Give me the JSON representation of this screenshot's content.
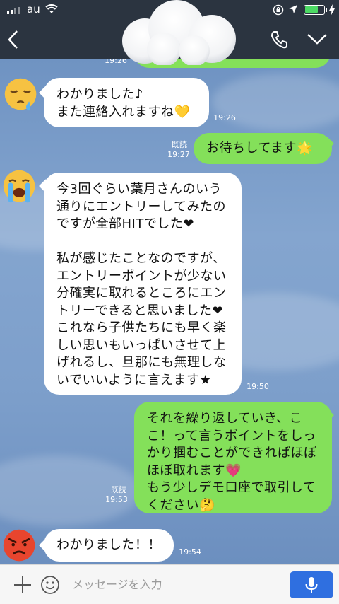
{
  "status": {
    "carrier": "au"
  },
  "messages": [
    {
      "id": "m0",
      "dir": "out",
      "time": "19:26",
      "partial": true
    },
    {
      "id": "m1",
      "dir": "in",
      "text": "わかりました♪\nまた連絡入れますね💛",
      "time": "19:26",
      "avatar": "sleepy-face-emoji"
    },
    {
      "id": "m2",
      "dir": "out",
      "text": "お待ちしてます🌟",
      "read": "既読",
      "time": "19:27"
    },
    {
      "id": "m3",
      "dir": "in",
      "text": "今3回ぐらい葉月さんのいう\n通りにエントリーしてみたの\nですが全部HITでした❤\n\n私が感じたことなのですが、\nエントリーポイントが少ない\n分確実に取れるところにエン\nトリーできると思いました❤\nこれなら子供たちにも早く楽\nしい思いもいっぱいさせて上\nげれるし、旦那にも無理しな\nいでいいように言えます★",
      "time": "19:50",
      "avatar": "crying-face-emoji"
    },
    {
      "id": "m4",
      "dir": "out",
      "text": "それを繰り返していき、こ\nこ！って言うポイントをしっ\nかり掴むことができればほぼ\nほぼ取れます💗\nもう少しデモ口座で取引して\nください🤔",
      "read": "既読",
      "time": "19:53"
    },
    {
      "id": "m5",
      "dir": "in",
      "text": "わかりました！！",
      "time": "19:54",
      "avatar": "angry-face-emoji"
    }
  ],
  "input": {
    "placeholder": "メッセージを入力"
  }
}
